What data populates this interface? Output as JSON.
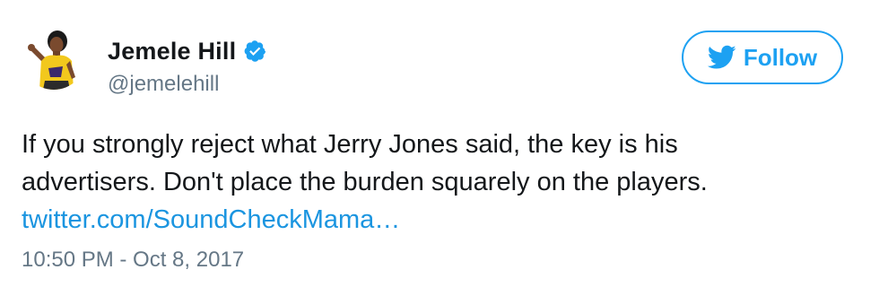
{
  "user": {
    "display_name": "Jemele Hill",
    "handle": "@jemelehill",
    "verified": true,
    "avatar_icon": "user-avatar-photo"
  },
  "follow_button": {
    "label": "Follow",
    "icon": "twitter-bird-icon"
  },
  "tweet": {
    "text_lines": [
      "If you strongly reject what Jerry Jones said, the key is his",
      "advertisers. Don't place the burden squarely on the players."
    ],
    "link": "twitter.com/SoundCheckMama…",
    "timestamp": "10:50 PM - Oct 8, 2017"
  },
  "colors": {
    "twitter_blue": "#1da1f2",
    "link_blue": "#1b95e0",
    "secondary_text": "#657786",
    "primary_text": "#14171a"
  }
}
